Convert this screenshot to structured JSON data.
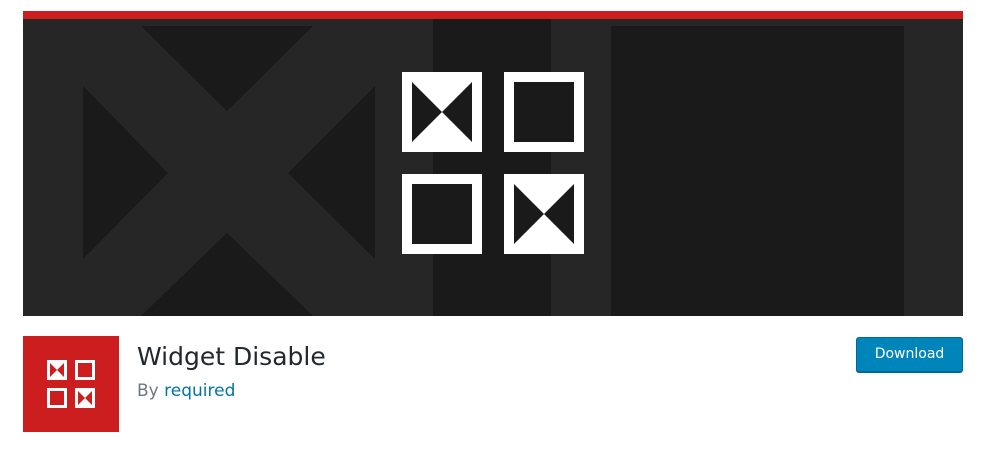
{
  "plugin": {
    "name": "Widget Disable",
    "author_prefix": "By",
    "author_name": "required"
  },
  "actions": {
    "download_label": "Download"
  },
  "colors": {
    "brand_red": "#cc1e1e",
    "banner_dark": "#262626",
    "banner_darker": "#1a1a1a",
    "button_blue": "#0085ba",
    "link_blue": "#0073aa"
  },
  "icons": {
    "banner_mark": "widget-grid-icon",
    "plugin_icon": "widget-grid-icon"
  }
}
